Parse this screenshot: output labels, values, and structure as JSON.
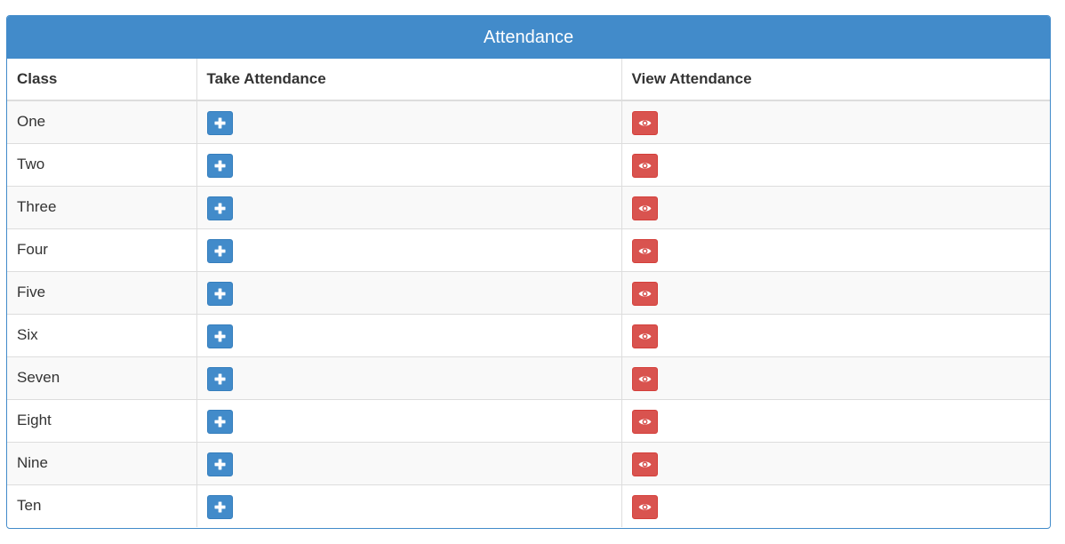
{
  "panel": {
    "title": "Attendance"
  },
  "table": {
    "headers": [
      "Class",
      "Take Attendance",
      "View Attendance"
    ],
    "rows": [
      {
        "class": "One"
      },
      {
        "class": "Two"
      },
      {
        "class": "Three"
      },
      {
        "class": "Four"
      },
      {
        "class": "Five"
      },
      {
        "class": "Six"
      },
      {
        "class": "Seven"
      },
      {
        "class": "Eight"
      },
      {
        "class": "Nine"
      },
      {
        "class": "Ten"
      }
    ]
  },
  "icons": {
    "take": "plus-icon",
    "view": "eye-icon"
  },
  "colors": {
    "primary": "#428bca",
    "danger": "#d9534f"
  }
}
